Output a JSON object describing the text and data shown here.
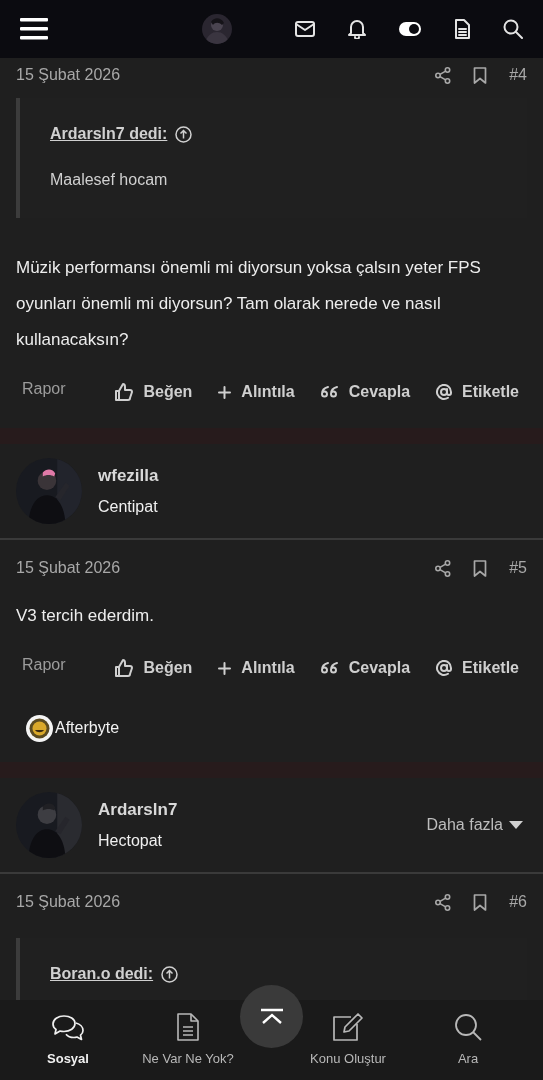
{
  "posts": [
    {
      "date": "15 Şubat 2026",
      "number": "#4",
      "quote": {
        "author": "Ardarsln7 dedi:",
        "text": "Maalesef hocam"
      },
      "body": "Müzik performansı önemli mi diyorsun yoksa çalsın yeter FPS oyunları önemli mi diyorsun? Tam olarak nerede ve nasıl kullanacaksın?",
      "actions": {
        "report": "Rapor",
        "buttons": [
          {
            "kind": "like",
            "label": "Beğen"
          },
          {
            "kind": "quote",
            "label": "Alıntıla"
          },
          {
            "kind": "reply",
            "label": "Cevapla"
          },
          {
            "kind": "mention",
            "label": "Etiketle"
          }
        ]
      }
    },
    {
      "user": {
        "name": "wfezilla",
        "title": "Centipat"
      },
      "date": "15 Şubat 2026",
      "number": "#5",
      "body": "V3 tercih ederdim.",
      "actions": {
        "report": "Rapor",
        "buttons": [
          {
            "kind": "like",
            "label": "Beğen"
          },
          {
            "kind": "quote",
            "label": "Alıntıla"
          },
          {
            "kind": "reply",
            "label": "Cevapla"
          },
          {
            "kind": "mention",
            "label": "Etiketle"
          }
        ]
      },
      "reactions": [
        {
          "name": "Afterbyte"
        }
      ]
    },
    {
      "user": {
        "name": "Ardarsln7",
        "title": "Hectopat",
        "more": "Daha fazla"
      },
      "date": "15 Şubat 2026",
      "number": "#6",
      "quote": {
        "author": "Boran.o dedi:"
      }
    }
  ],
  "bottom_nav": [
    {
      "kind": "chat",
      "label": "Sosyal",
      "selected": true
    },
    {
      "kind": "doc",
      "label": "Ne Var Ne Yok?",
      "selected": false
    },
    {
      "kind": "edit",
      "label": "Konu Oluştur",
      "selected": false
    },
    {
      "kind": "search",
      "label": "Ara",
      "selected": false
    }
  ]
}
